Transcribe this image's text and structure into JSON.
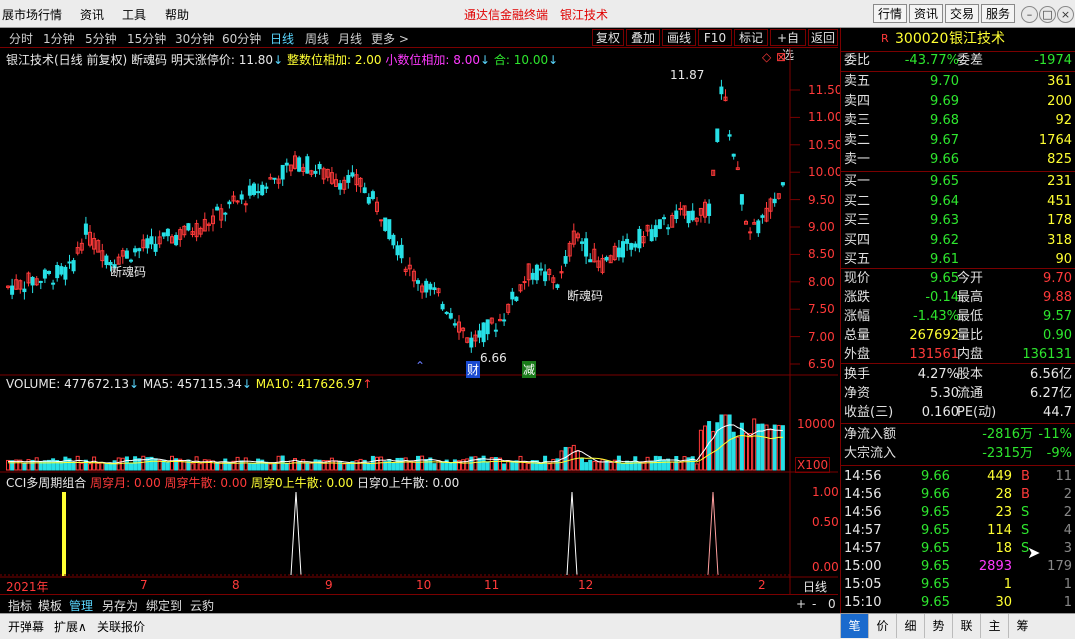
{
  "menu": {
    "app_name": "展市场行情",
    "items": [
      "资讯",
      "工具",
      "帮助"
    ],
    "center_title": "通达信金融终端",
    "center_stock": "银江技术",
    "right_buttons": [
      "行情",
      "资讯",
      "交易",
      "服务"
    ]
  },
  "periods": [
    "分时",
    "1分钟",
    "5分钟",
    "15分钟",
    "30分钟",
    "60分钟",
    "日线",
    "周线",
    "月线",
    "更多 >"
  ],
  "active_period": "日线",
  "toolbar": [
    "复权",
    "叠加",
    "画线",
    "F10",
    "标记",
    "+自选",
    "返回"
  ],
  "main_indicator": {
    "title": "银江技术(日线 前复权) 断魂码",
    "limit_label": "明天涨停价:",
    "limit_value": "11.80",
    "int_label": "整数位相加:",
    "int_value": "2.00",
    "dec_label": "小数位相加:",
    "dec_value": "8.00",
    "sum_label": "合:",
    "sum_value": "10.00"
  },
  "price_axis": [
    "11.50",
    "11.00",
    "10.50",
    "10.00",
    "9.50",
    "9.00",
    "8.50",
    "8.00",
    "7.50",
    "7.00",
    "6.50"
  ],
  "annotations": {
    "high": "11.87",
    "low": "6.66",
    "tag1": "断魂码",
    "tag2": "断魂码",
    "mark_cai": "财",
    "mark_jian": "减"
  },
  "volume": {
    "label": "VOLUME:",
    "value": "477672.13",
    "ma5_label": "MA5:",
    "ma5": "457115.34",
    "ma10_label": "MA10:",
    "ma10": "417626.97",
    "axis": "10000",
    "unit": "X100"
  },
  "cci": {
    "title": "CCI多周期组合",
    "week_month": "周穿月: 0.00",
    "week_cow": "周穿牛散: 0.00",
    "zero_cow": "周穿0上牛散: 0.00",
    "day_cow": "日穿0上牛散: 0.00",
    "axis": [
      "1.00",
      "0.50",
      "0.00"
    ]
  },
  "time_axis": [
    "2021年",
    "7",
    "8",
    "9",
    "10",
    "11",
    "12",
    "2"
  ],
  "time_label": "日线",
  "bottom_tabs": [
    "指标",
    "模板",
    "管理",
    "另存为",
    "绑定到",
    "云豹"
  ],
  "bottom_active": "管理",
  "bottom_right": [
    "+",
    "-",
    "0"
  ],
  "bottom_bar": [
    "开弹幕",
    "扩展∧",
    "关联报价"
  ],
  "right_tabs": [
    "笔",
    "价",
    "细",
    "势",
    "联",
    "主",
    "筹"
  ],
  "right_tab_active": "笔",
  "quote": {
    "code": "300020",
    "name": "银江技术",
    "flag": "R",
    "weibi_label": "委比",
    "weibi": "-43.77%",
    "weicha_label": "委差",
    "weicha": "-1974",
    "sells": [
      {
        "label": "卖五",
        "price": "9.70",
        "vol": "361"
      },
      {
        "label": "卖四",
        "price": "9.69",
        "vol": "200"
      },
      {
        "label": "卖三",
        "price": "9.68",
        "vol": "92"
      },
      {
        "label": "卖二",
        "price": "9.67",
        "vol": "1764"
      },
      {
        "label": "卖一",
        "price": "9.66",
        "vol": "825"
      }
    ],
    "buys": [
      {
        "label": "买一",
        "price": "9.65",
        "vol": "231"
      },
      {
        "label": "买二",
        "price": "9.64",
        "vol": "451"
      },
      {
        "label": "买三",
        "price": "9.63",
        "vol": "178"
      },
      {
        "label": "买四",
        "price": "9.62",
        "vol": "318"
      },
      {
        "label": "买五",
        "price": "9.61",
        "vol": "90"
      }
    ],
    "stats": [
      {
        "l1": "现价",
        "v1": "9.65",
        "c1": "grn",
        "l2": "今开",
        "v2": "9.70",
        "c2": "red"
      },
      {
        "l1": "涨跌",
        "v1": "-0.14",
        "c1": "grn",
        "l2": "最高",
        "v2": "9.88",
        "c2": "red"
      },
      {
        "l1": "涨幅",
        "v1": "-1.43%",
        "c1": "grn",
        "l2": "最低",
        "v2": "9.57",
        "c2": "grn"
      },
      {
        "l1": "总量",
        "v1": "267692",
        "c1": "yel",
        "l2": "量比",
        "v2": "0.90",
        "c2": "grn"
      },
      {
        "l1": "外盘",
        "v1": "131561",
        "c1": "red",
        "l2": "内盘",
        "v2": "136131",
        "c2": "grn"
      }
    ],
    "stats2": [
      {
        "l1": "换手",
        "v1": "4.27%",
        "l2": "股本",
        "v2": "6.56亿"
      },
      {
        "l1": "净资",
        "v1": "5.30",
        "l2": "流通",
        "v2": "6.27亿"
      },
      {
        "l1": "收益(三)",
        "v1": "0.160",
        "l2": "PE(动)",
        "v2": "44.7"
      }
    ],
    "flows": [
      {
        "label": "净流入额",
        "val": "-2816万",
        "pct": "-11%"
      },
      {
        "label": "大宗流入",
        "val": "-2315万",
        "pct": "-9%"
      }
    ],
    "ticks": [
      {
        "t": "14:56",
        "p": "9.66",
        "v": "449",
        "bs": "B",
        "n": "11",
        "vc": "yel"
      },
      {
        "t": "14:56",
        "p": "9.66",
        "v": "28",
        "bs": "B",
        "n": "2",
        "vc": "yel"
      },
      {
        "t": "14:56",
        "p": "9.65",
        "v": "23",
        "bs": "S",
        "n": "2",
        "vc": "yel"
      },
      {
        "t": "14:57",
        "p": "9.65",
        "v": "114",
        "bs": "S",
        "n": "4",
        "vc": "yel"
      },
      {
        "t": "14:57",
        "p": "9.65",
        "v": "18",
        "bs": "S",
        "n": "3",
        "vc": "yel"
      },
      {
        "t": "15:00",
        "p": "9.65",
        "v": "2893",
        "bs": "",
        "n": "179",
        "vc": "mag"
      },
      {
        "t": "15:05",
        "p": "9.65",
        "v": "1",
        "bs": "",
        "n": "1",
        "vc": "yel"
      },
      {
        "t": "15:10",
        "p": "9.65",
        "v": "30",
        "bs": "",
        "n": "1",
        "vc": "yel"
      }
    ]
  },
  "colors": {
    "up": "#ff3a3a",
    "down": "#27e0e6",
    "grid": "#7a0000",
    "ma5": "#ffffff",
    "ma10": "#ffff33"
  }
}
